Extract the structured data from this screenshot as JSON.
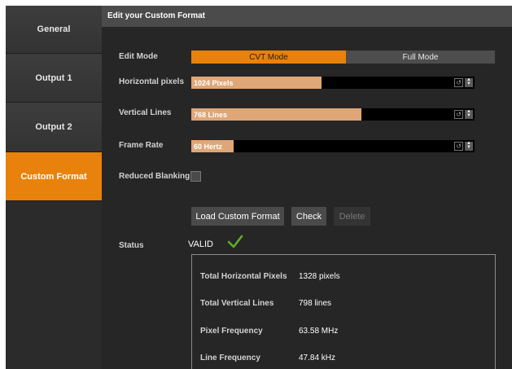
{
  "sidebar": {
    "items": [
      {
        "label": "General"
      },
      {
        "label": "Output 1"
      },
      {
        "label": "Output 2"
      },
      {
        "label": "Custom Format",
        "active": true
      }
    ]
  },
  "panel": {
    "title": "Edit your Custom Format"
  },
  "edit_mode": {
    "label": "Edit Mode",
    "options": [
      "CVT Mode",
      "Full Mode"
    ],
    "selected": "CVT Mode"
  },
  "horizontal": {
    "label": "Horizontal pixels",
    "value": "1024 Pixels",
    "level": 0.46
  },
  "vertical": {
    "label": "Vertical Lines",
    "value": "768 Lines",
    "level": 0.6
  },
  "frame_rate": {
    "label": "Frame Rate",
    "value": "60 Hertz",
    "level": 0.15
  },
  "reduced_blanking": {
    "label": "Reduced Blanking",
    "checked": false
  },
  "buttons": {
    "load": "Load Custom Format",
    "check": "Check",
    "delete": "Delete"
  },
  "status": {
    "label": "Status",
    "value": "VALID"
  },
  "info": {
    "rows": [
      {
        "label": "Total Horizontal Pixels",
        "value": "1328 pixels"
      },
      {
        "label": "Total Vertical Lines",
        "value": "798 lines"
      },
      {
        "label": "Pixel Frequency",
        "value": "63.58 MHz"
      },
      {
        "label": "Line Frequency",
        "value": "47.84 kHz"
      }
    ]
  },
  "colors": {
    "accent": "#e8820c",
    "slider_fill": "#dfa677",
    "valid": "#5fae2a"
  },
  "icons": {
    "valid": "check-icon",
    "reset": "reset-icon",
    "spinner": "spinner-icon"
  }
}
